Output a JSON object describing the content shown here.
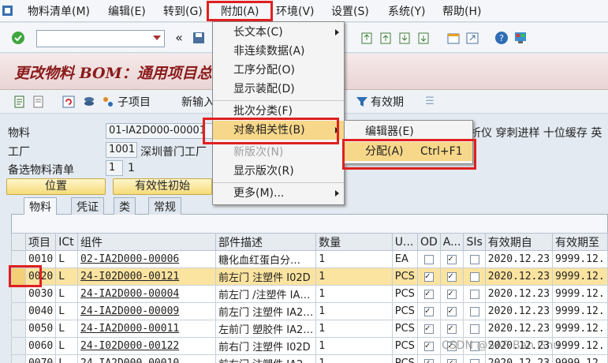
{
  "menubar": {
    "items": [
      "物料清单(M)",
      "编辑(E)",
      "转到(G)",
      "附加(A)",
      "环境(V)",
      "设置(S)",
      "系统(Y)",
      "帮助(H)"
    ]
  },
  "page_title": "更改物料 BOM：通用项目总",
  "toolbar2": {
    "sub_item_label": "子项目",
    "new_entry_label": "新输入",
    "validity_label": "有效期"
  },
  "header": {
    "material_label": "物料",
    "material_value": "01-IA2D000-00001",
    "material_desc_tail": "析仪 穿刺进样 十位缓存 英",
    "plant_label": "工厂",
    "plant_value": "1001",
    "plant_desc": "深圳普门工厂",
    "alt_bom_label": "备选物料清单",
    "alt_bom_value": "1",
    "alt_bom_extra": "1",
    "position_button": "位置",
    "validity_init_button": "有效性初始"
  },
  "tabs": [
    "物料",
    "凭证",
    "类",
    "常规"
  ],
  "table": {
    "columns": [
      "项目",
      "ICt",
      "组件",
      "部件描述",
      "数量",
      "U...",
      "OD",
      "A...",
      "SIs",
      "有效期自",
      "有效期至"
    ],
    "rows": [
      {
        "item": "0010",
        "ict": "L",
        "component": "02-IA2D000-00006",
        "desc": "糖化血红蛋白分…",
        "qty": "1",
        "unit": "EA",
        "od": false,
        "a": true,
        "sis": false,
        "valid_from": "2020.12.23",
        "valid_to": "9999.12."
      },
      {
        "item": "0020",
        "ict": "L",
        "component": "24-I02D000-00121",
        "desc": "前左门 注塑件 I02D",
        "qty": "1",
        "unit": "PCS",
        "od": true,
        "a": true,
        "sis": false,
        "valid_from": "2020.12.23",
        "valid_to": "9999.12."
      },
      {
        "item": "0030",
        "ict": "L",
        "component": "24-IA2D000-00004",
        "desc": "前左门 /注塑件 IA…",
        "qty": "1",
        "unit": "PCS",
        "od": true,
        "a": true,
        "sis": false,
        "valid_from": "2020.12.23",
        "valid_to": "9999.12."
      },
      {
        "item": "0040",
        "ict": "L",
        "component": "24-IA2D000-00009",
        "desc": "前左门 注塑件 IA2…",
        "qty": "1",
        "unit": "PCS",
        "od": true,
        "a": true,
        "sis": false,
        "valid_from": "2020.12.23",
        "valid_to": "9999.12."
      },
      {
        "item": "0050",
        "ict": "L",
        "component": "24-IA2D000-00011",
        "desc": "左前门 塑胶件 IA2…",
        "qty": "1",
        "unit": "PCS",
        "od": true,
        "a": true,
        "sis": false,
        "valid_from": "2020.12.23",
        "valid_to": "9999.12."
      },
      {
        "item": "0060",
        "ict": "L",
        "component": "24-I02D000-00122",
        "desc": "前右门 注塑件 I02D",
        "qty": "1",
        "unit": "PCS",
        "od": true,
        "a": true,
        "sis": false,
        "valid_from": "2020.12.23",
        "valid_to": "9999.12."
      },
      {
        "item": "0070",
        "ict": "L",
        "component": "24-IA2D000-00010",
        "desc": "前右门 注塑件 IA2…",
        "qty": "1",
        "unit": "PCS",
        "od": true,
        "a": true,
        "sis": false,
        "valid_from": "2020.12.23",
        "valid_to": "9999.12."
      }
    ]
  },
  "extras_menu": {
    "items": [
      {
        "label": "长文本(C)",
        "submenu": true,
        "disabled": false
      },
      {
        "label": "非连续数据(A)",
        "submenu": false,
        "disabled": false
      },
      {
        "label": "工序分配(O)",
        "submenu": false,
        "disabled": false
      },
      {
        "label": "显示装配(D)",
        "submenu": false,
        "disabled": false
      },
      {
        "label": "批次分类(F)",
        "submenu": false,
        "disabled": false
      },
      {
        "label": "对象相关性(B)",
        "submenu": true,
        "disabled": false
      },
      {
        "label": "新版次(N)",
        "submenu": false,
        "disabled": true
      },
      {
        "label": "显示版次(R)",
        "submenu": false,
        "disabled": false
      },
      {
        "label": "更多(M)...",
        "submenu": true,
        "disabled": false
      }
    ]
  },
  "dependency_submenu": {
    "items": [
      {
        "label": "编辑器(E)",
        "shortcut": ""
      },
      {
        "label": "分配(A)",
        "shortcut": "Ctrl+F1"
      }
    ]
  },
  "watermark": "CSDN @SAP Ban Gnu",
  "colors": {
    "highlight_row": "#fbe3a0",
    "menu_hover": "#f7d789",
    "annotation_red": "#e02020",
    "title_text": "#8a1a1a"
  }
}
